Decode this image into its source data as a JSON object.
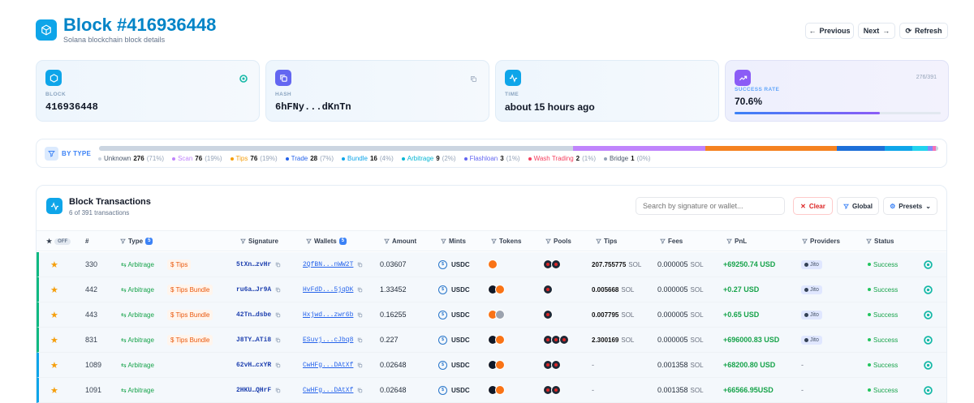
{
  "header": {
    "title": "Block #416936448",
    "subtitle": "Solana blockchain block details",
    "previous_label": "Previous",
    "next_label": "Next",
    "refresh_label": "Refresh"
  },
  "cards": {
    "block": {
      "label": "BLOCK",
      "value": "416936448"
    },
    "hash": {
      "label": "HASH",
      "value": "6hFNy...dKnTn"
    },
    "time": {
      "label": "TIME",
      "value": "about 15 hours ago"
    },
    "success": {
      "label": "SUCCESS RATE",
      "value": "70.6%",
      "count": "276/391",
      "progress": 0.706
    }
  },
  "by_type": {
    "label": "BY TYPE",
    "items": [
      {
        "name": "Unknown",
        "count": "276",
        "pct": "(71%)",
        "color": "#cbd5e1"
      },
      {
        "name": "Scan",
        "count": "76",
        "pct": "(19%)",
        "color": "#c084fc"
      },
      {
        "name": "Tips",
        "count": "76",
        "pct": "(19%)",
        "color": "#f59e0b"
      },
      {
        "name": "Trade",
        "count": "28",
        "pct": "(7%)",
        "color": "#2563eb"
      },
      {
        "name": "Bundle",
        "count": "16",
        "pct": "(4%)",
        "color": "#0ea5e9"
      },
      {
        "name": "Arbitrage",
        "count": "9",
        "pct": "(2%)",
        "color": "#06b6d4"
      },
      {
        "name": "Flashloan",
        "count": "3",
        "pct": "(1%)",
        "color": "#6366f1"
      },
      {
        "name": "Wash Trading",
        "count": "2",
        "pct": "(1%)",
        "color": "#f43f5e"
      },
      {
        "name": "Bridge",
        "count": "1",
        "pct": "(0%)",
        "color": "#94a3b8"
      }
    ],
    "bar": [
      {
        "color": "#cbd5e1",
        "frac": 0.565
      },
      {
        "color": "#c084fc",
        "frac": 0.157
      },
      {
        "color": "#f58220",
        "frac": 0.157
      },
      {
        "color": "#1d6fd8",
        "frac": 0.057
      },
      {
        "color": "#0ea5e9",
        "frac": 0.033
      },
      {
        "color": "#22d3ee",
        "frac": 0.018
      },
      {
        "color": "#818cf8",
        "frac": 0.006
      },
      {
        "color": "#f472b6",
        "frac": 0.004
      },
      {
        "color": "#cbd5e1",
        "frac": 0.003
      }
    ]
  },
  "panel": {
    "title": "Block Transactions",
    "subtitle": "6 of 391 transactions",
    "search_placeholder": "Search by signature or wallet...",
    "clear_label": "Clear",
    "global_label": "Global",
    "presets_label": "Presets",
    "columns": {
      "off": "OFF",
      "num": "#",
      "type": "Type",
      "type_count": "5",
      "signature": "Signature",
      "wallets": "Wallets",
      "wallets_count": "5",
      "amount": "Amount",
      "mints": "Mints",
      "tokens": "Tokens",
      "pools": "Pools",
      "tips": "Tips",
      "fees": "Fees",
      "pnl": "PnL",
      "providers": "Providers",
      "status": "Status"
    },
    "rows": [
      {
        "num": "330",
        "type": "Arbitrage",
        "tag": "$ Tips",
        "sig": "5tXn…zvHr",
        "wallet": "2QfBN...nWW2T",
        "amount": "0.03607",
        "mint": "USDC",
        "tips": "207.755775",
        "tips_unit": "SOL",
        "fee": "0.000005",
        "fee_unit": "SOL",
        "pnl": "+69250.74 USD",
        "provider": "Jito",
        "status": "Success"
      },
      {
        "num": "442",
        "type": "Arbitrage",
        "tag": "$ Tips Bundle",
        "sig": "ru6a…Jr9A",
        "wallet": "HvFdD...5jqDK",
        "amount": "1.33452",
        "mint": "USDC",
        "tips": "0.005668",
        "tips_unit": "SOL",
        "fee": "0.000005",
        "fee_unit": "SOL",
        "pnl": "+0.27 USD",
        "provider": "Jito",
        "status": "Success"
      },
      {
        "num": "443",
        "type": "Arbitrage",
        "tag": "$ Tips Bundle",
        "sig": "42Tn…dsbe",
        "wallet": "Hxjwd...zwr6b",
        "amount": "0.16255",
        "mint": "USDC",
        "tips": "0.007795",
        "tips_unit": "SOL",
        "fee": "0.000005",
        "fee_unit": "SOL",
        "pnl": "+0.65 USD",
        "provider": "Jito",
        "status": "Success"
      },
      {
        "num": "831",
        "type": "Arbitrage",
        "tag": "$ Tips Bundle",
        "sig": "J8TY…ATi8",
        "wallet": "ESuvj...cJbq8",
        "amount": "0.227",
        "mint": "USDC",
        "tips": "2.300169",
        "tips_unit": "SOL",
        "fee": "0.000005",
        "fee_unit": "SOL",
        "pnl": "+696000.83 USD",
        "provider": "Jito",
        "status": "Success"
      },
      {
        "num": "1089",
        "type": "Arbitrage",
        "tag": "",
        "sig": "62vH…cxYR",
        "wallet": "CwHFg...DAtXf",
        "amount": "0.02648",
        "mint": "USDC",
        "tips": "-",
        "tips_unit": "",
        "fee": "0.001358",
        "fee_unit": "SOL",
        "pnl": "+68200.80 USD",
        "provider": "-",
        "status": "Success"
      },
      {
        "num": "1091",
        "type": "Arbitrage",
        "tag": "",
        "sig": "2HKU…QHrF",
        "wallet": "CwHFg...DAtXf",
        "amount": "0.02648",
        "mint": "USDC",
        "tips": "-",
        "tips_unit": "",
        "fee": "0.001358",
        "fee_unit": "SOL",
        "pnl": "+66566.95USD",
        "provider": "-",
        "status": "Success"
      }
    ]
  }
}
